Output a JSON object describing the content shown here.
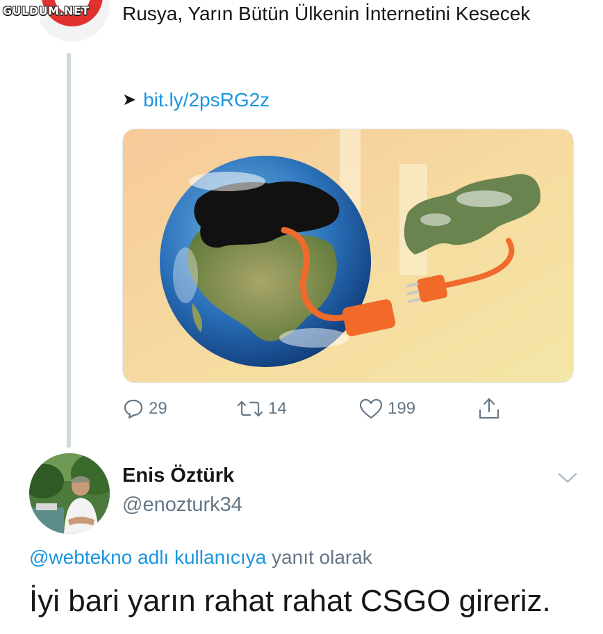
{
  "watermark": "GULDUM.NET",
  "tweet": {
    "text": "Rusya, Yarın Bütün Ülkenin İnternetini Kesecek",
    "link_arrow": "➤",
    "link": "bit.ly/2psRG2z",
    "actions": {
      "replies": "29",
      "retweets": "14",
      "likes": "199"
    }
  },
  "reply": {
    "name": "Enis Öztürk",
    "handle": "@enozturk34",
    "mention": "@webtekno adlı kullanıcıya",
    "reply_suffix": " yanıt olarak",
    "text": "İyi bari yarın rahat rahat CSGO gireriz."
  },
  "colors": {
    "link": "#1b95e0",
    "muted": "#657786",
    "thread_line": "#cfd9de",
    "text": "#14171a"
  }
}
